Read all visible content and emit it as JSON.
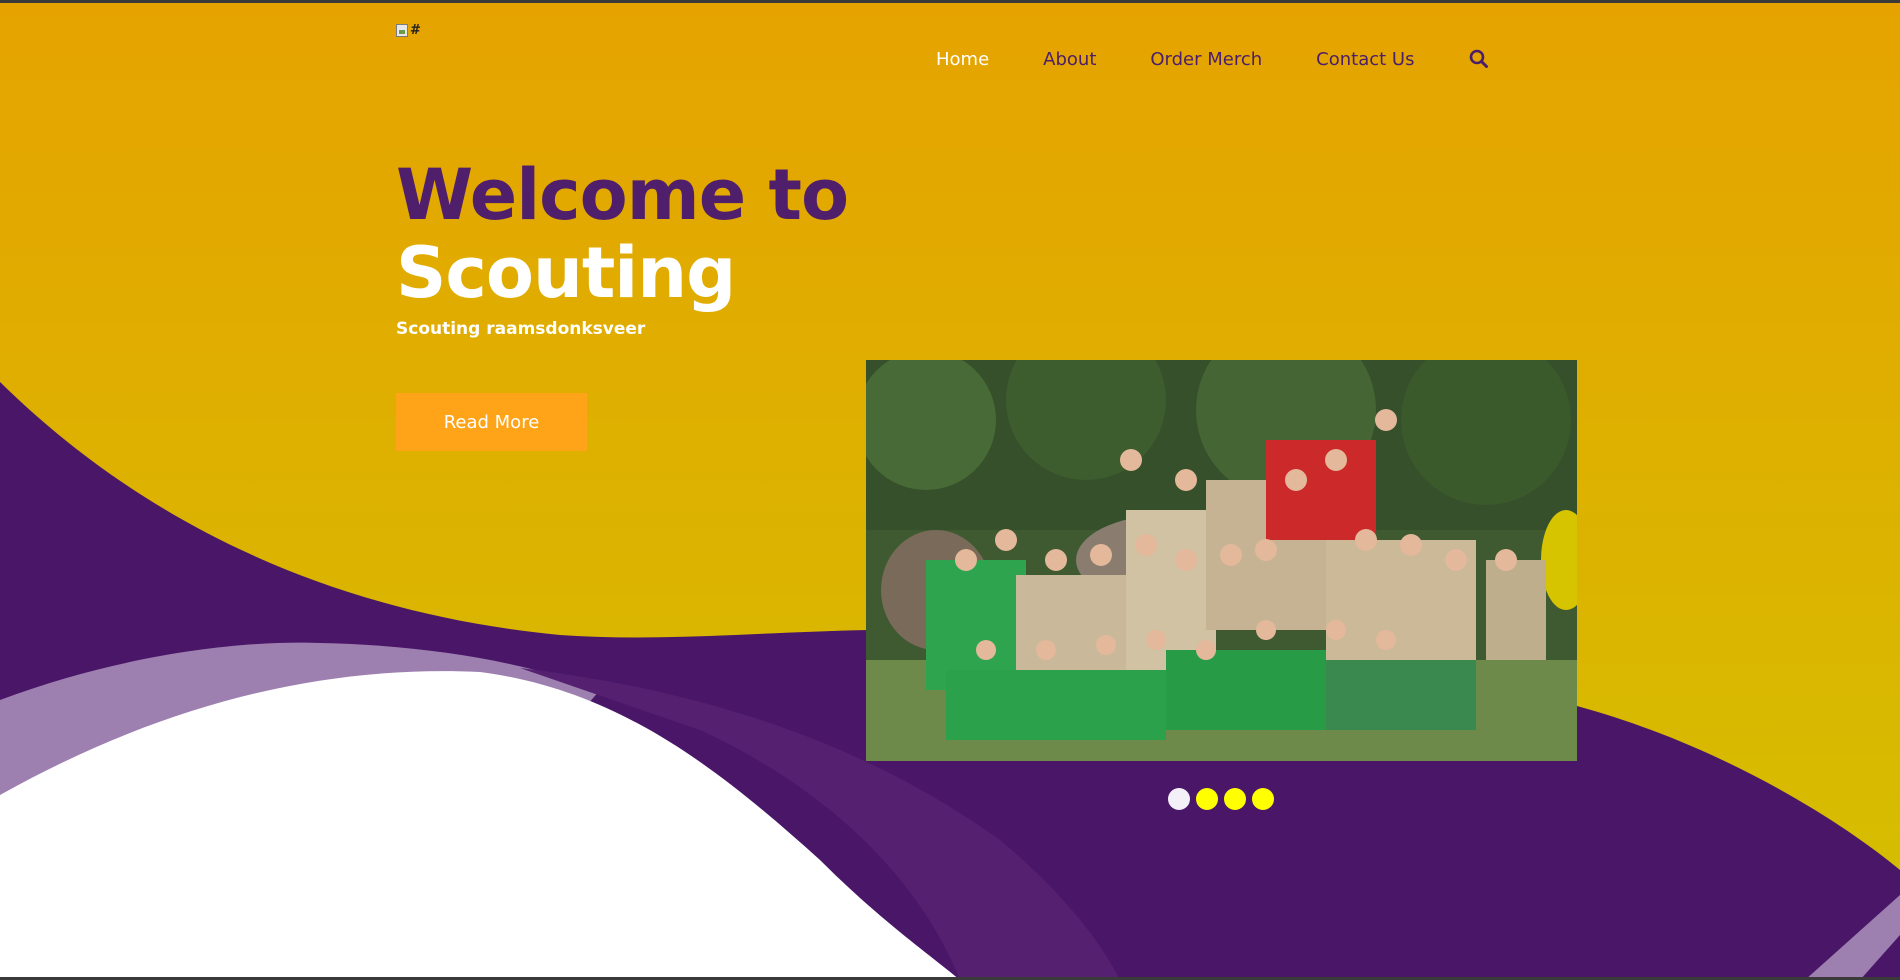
{
  "header": {
    "logo_alt": "#",
    "nav": [
      {
        "label": "Home",
        "active": true
      },
      {
        "label": "About",
        "active": false
      },
      {
        "label": "Order Merch",
        "active": false
      },
      {
        "label": "Contact Us",
        "active": false
      }
    ],
    "search_icon": "search-icon"
  },
  "hero": {
    "title_line1": "Welcome to",
    "title_line2": "Scouting",
    "subtitle": "Scouting raamsdonksveer",
    "cta_label": "Read More"
  },
  "slider": {
    "dots": [
      {
        "active": true
      },
      {
        "active": false
      },
      {
        "active": false
      },
      {
        "active": false
      }
    ]
  },
  "colors": {
    "gradient_top": "#e6a300",
    "gradient_bottom": "#d4c000",
    "purple": "#4a1768",
    "lavender": "#9d80b0",
    "orange_button": "#ffa319",
    "dot_active": "#f4f0f8",
    "dot": "#ffff00"
  }
}
